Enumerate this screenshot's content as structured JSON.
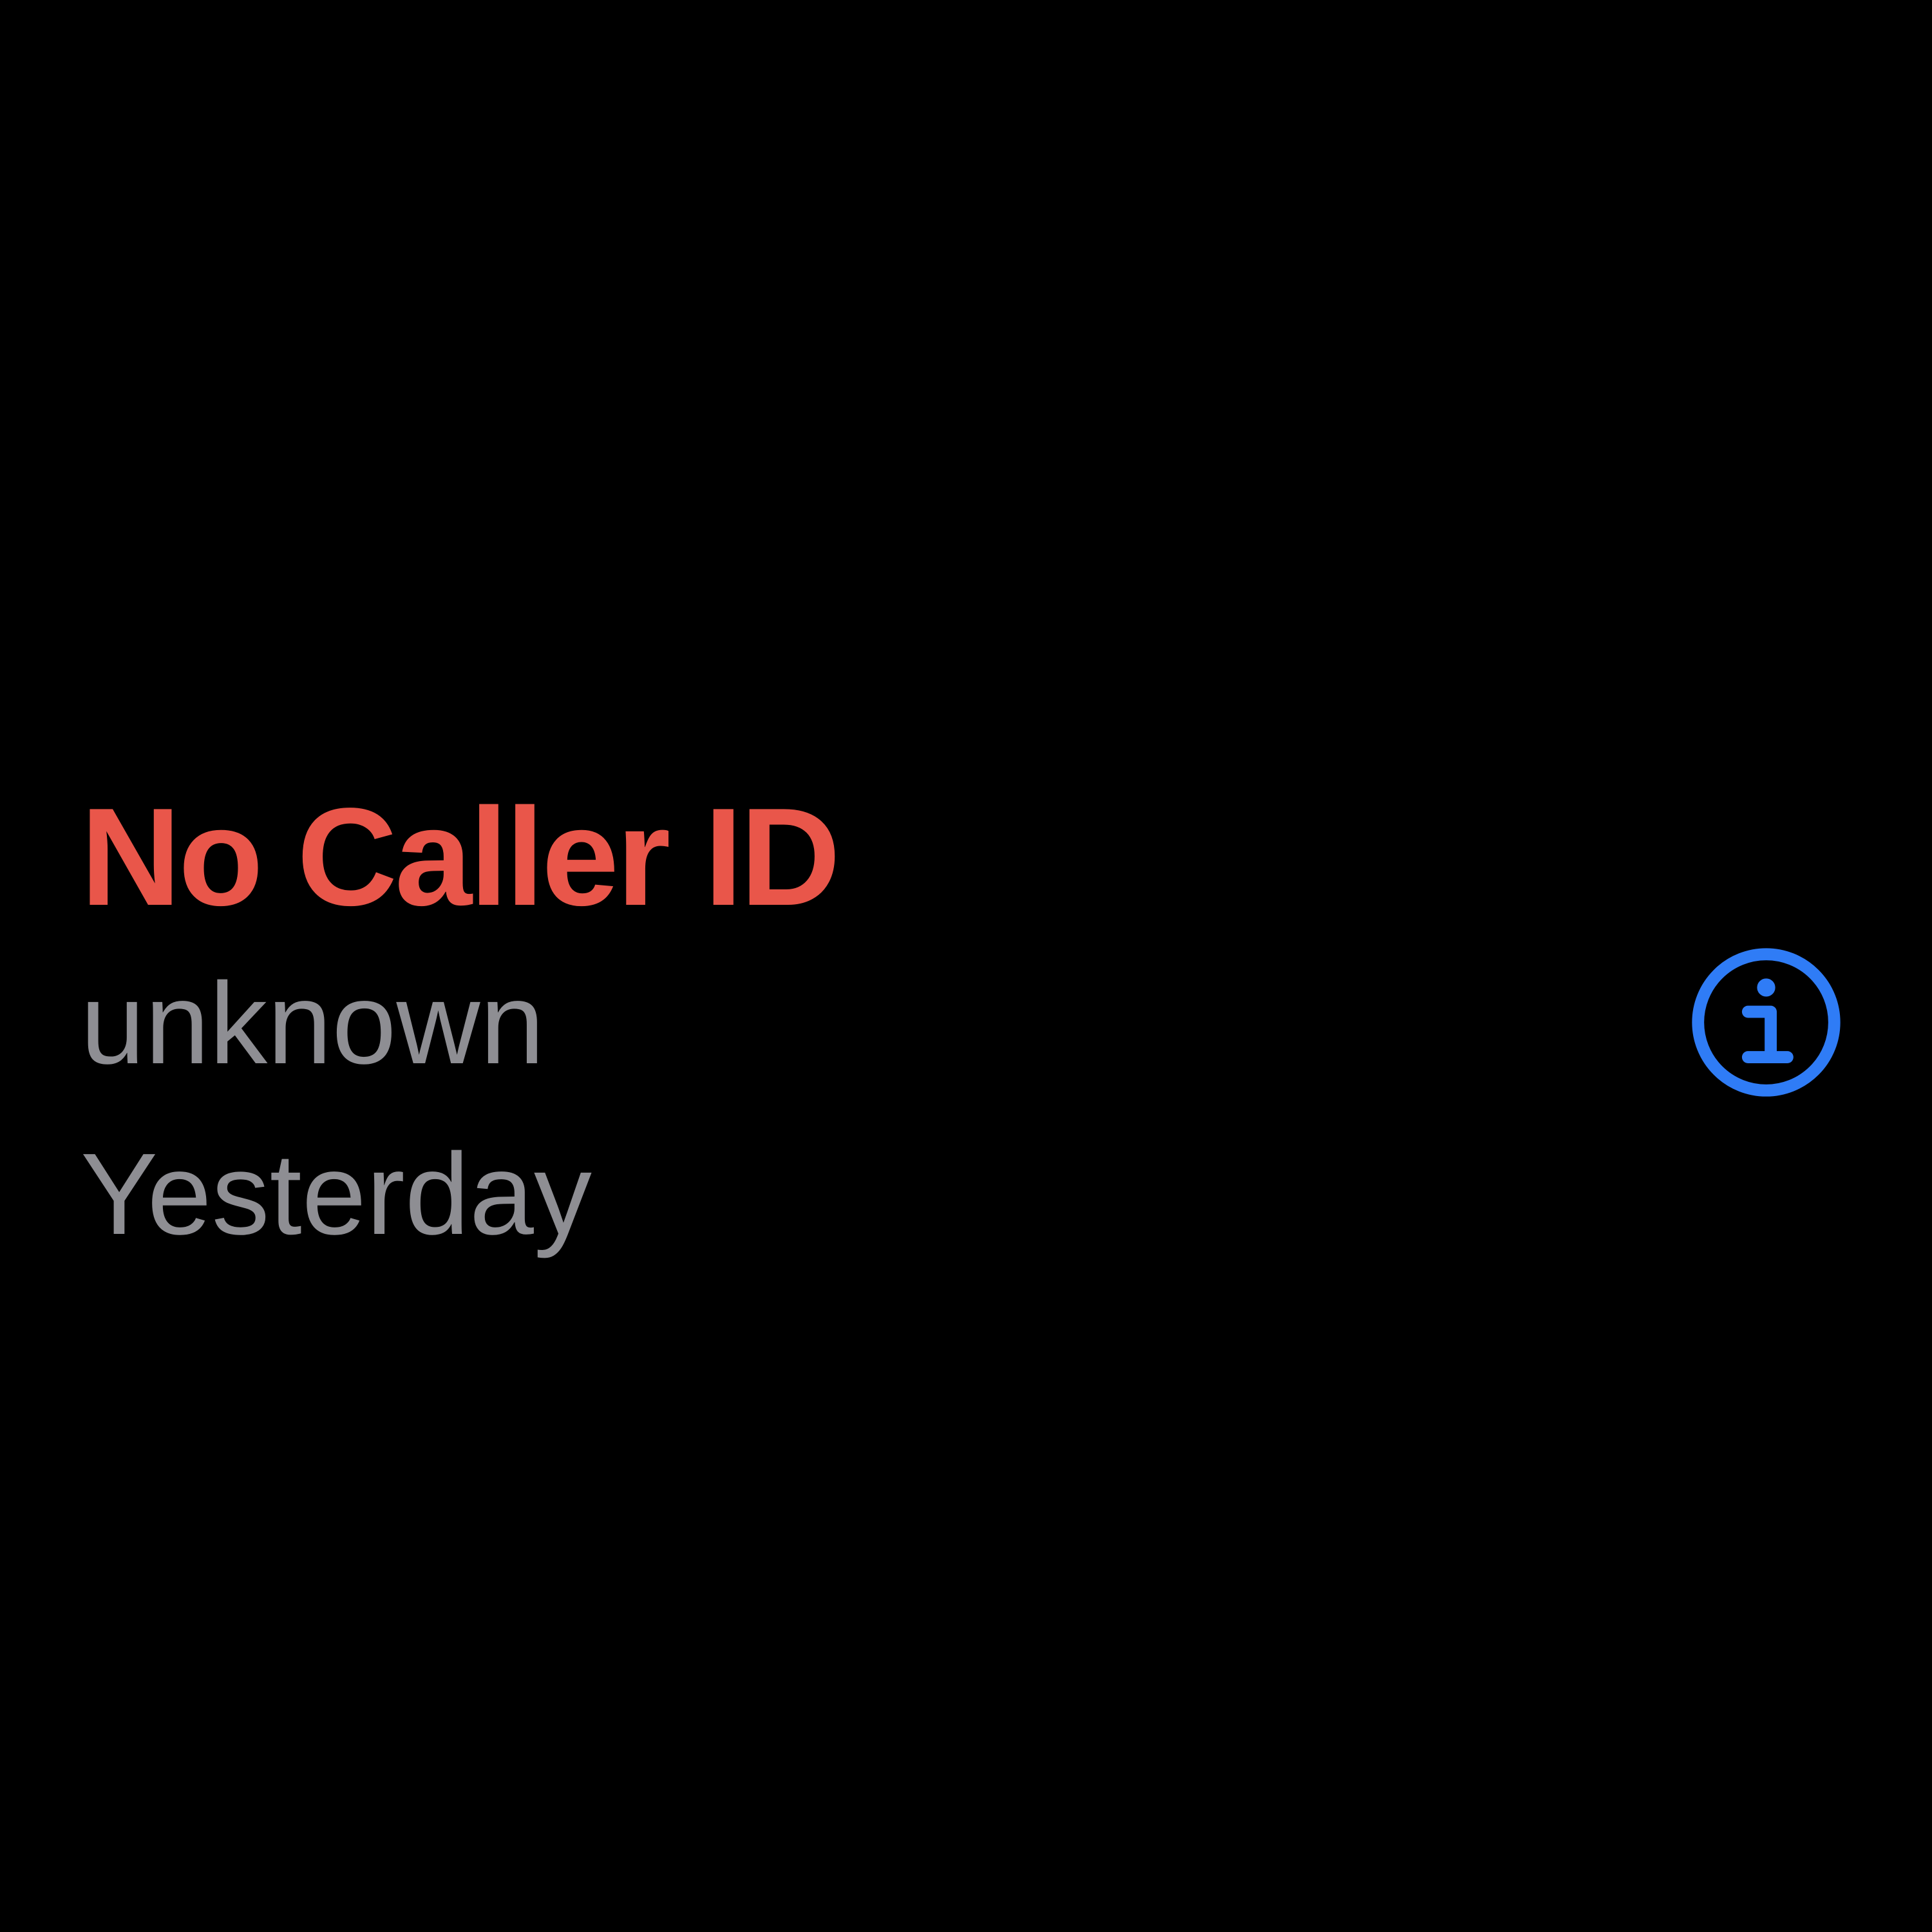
{
  "call": {
    "caller_name": "No Caller ID",
    "label": "unknown",
    "date": "Yesterday",
    "info_icon": "info-circle-icon"
  },
  "colors": {
    "background": "#000000",
    "missed_call": "#E9564A",
    "secondary_text": "#8E8E93",
    "accent": "#2F7CF6"
  }
}
